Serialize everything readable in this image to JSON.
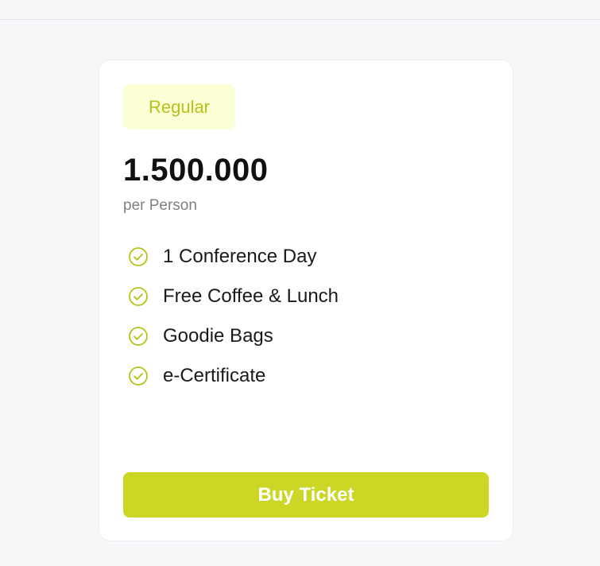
{
  "card": {
    "badge_label": "Regular",
    "price": "1.500.000",
    "price_unit": "per Person",
    "features": [
      "1 Conference Day",
      "Free Coffee & Lunch",
      "Goodie Bags",
      "e-Certificate"
    ],
    "buy_label": "Buy Ticket"
  },
  "colors": {
    "accent": "#cbd625",
    "badge_bg": "#fcfed6",
    "badge_text": "#b5c219",
    "page_bg": "#f6f7f9"
  },
  "icons": {
    "feature_icon": "check-circle-icon"
  }
}
